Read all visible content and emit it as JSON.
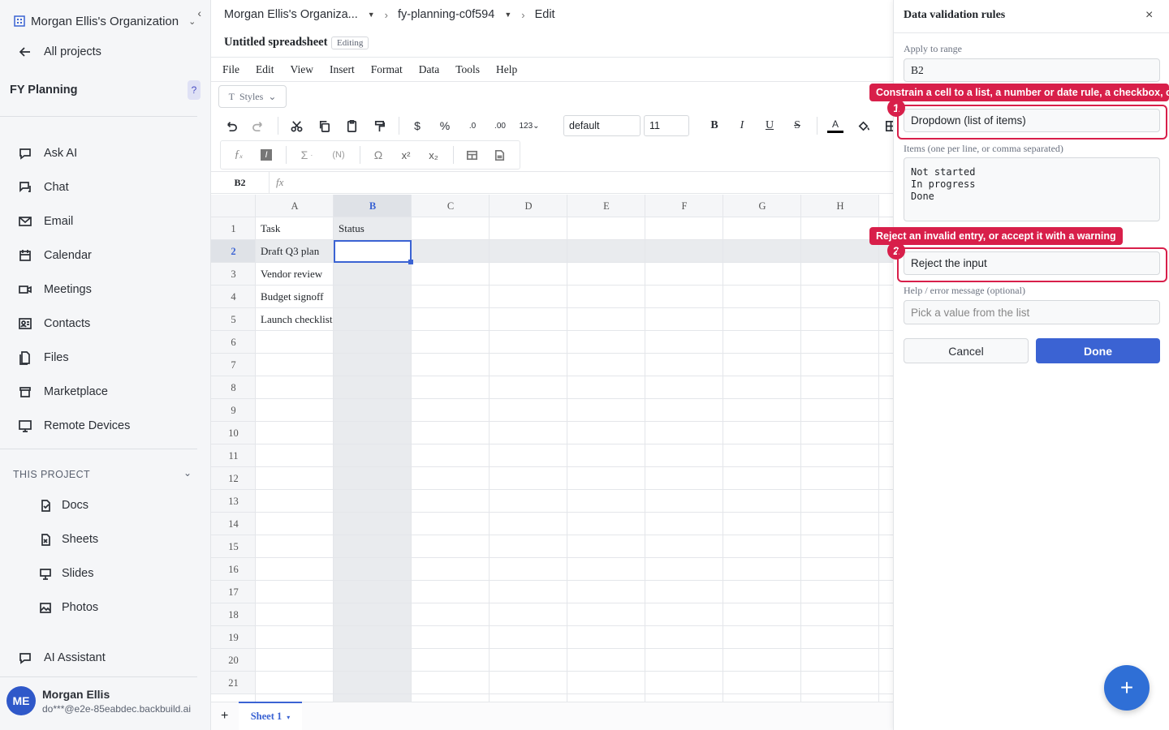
{
  "sidebar": {
    "org_name": "Morgan Ellis's Organization",
    "all_projects": "All projects",
    "project_title": "FY Planning",
    "help": "?",
    "nav": [
      {
        "label": "Ask AI",
        "icon": "chat-bubble-icon"
      },
      {
        "label": "Chat",
        "icon": "message-icon"
      },
      {
        "label": "Email",
        "icon": "mail-icon"
      },
      {
        "label": "Calendar",
        "icon": "calendar-icon"
      },
      {
        "label": "Meetings",
        "icon": "video-icon"
      },
      {
        "label": "Contacts",
        "icon": "contact-card-icon"
      },
      {
        "label": "Files",
        "icon": "files-icon"
      },
      {
        "label": "Marketplace",
        "icon": "store-icon"
      },
      {
        "label": "Remote Devices",
        "icon": "monitor-icon"
      }
    ],
    "section_label": "THIS PROJECT",
    "project_items": [
      {
        "label": "Docs",
        "icon": "doc-icon"
      },
      {
        "label": "Sheets",
        "icon": "sheet-icon"
      },
      {
        "label": "Slides",
        "icon": "presentation-icon"
      },
      {
        "label": "Photos",
        "icon": "photo-icon"
      }
    ],
    "ai_assistant": "AI Assistant",
    "user": {
      "initials": "ME",
      "name": "Morgan Ellis",
      "email": "do***@e2e-85eabdec.backbuild.ai"
    }
  },
  "header": {
    "crumb_org": "Morgan Ellis's Organiza...",
    "crumb_project": "fy-planning-c0f594",
    "crumb_mode": "Edit",
    "doc_title": "Untitled spreadsheet",
    "badge": "Editing"
  },
  "menu": [
    "File",
    "Edit",
    "View",
    "Insert",
    "Format",
    "Data",
    "Tools",
    "Help"
  ],
  "toolbar": {
    "styles": "Styles",
    "font": "default",
    "size": "11",
    "currency": "$",
    "percent": "%",
    "dec_less": ".0",
    "dec_more": ".00",
    "num_format": "123",
    "bold": "B",
    "italic": "I",
    "underline": "U",
    "strike": "S",
    "text_color": "A",
    "sigma": "Σ",
    "named": "(N)",
    "omega": "Ω"
  },
  "formula": {
    "cell_ref": "B2",
    "fx": "fx"
  },
  "grid": {
    "columns": [
      "A",
      "B",
      "C",
      "D",
      "E",
      "F",
      "G",
      "H"
    ],
    "rows": [
      "1",
      "2",
      "3",
      "4",
      "5",
      "6",
      "7",
      "8",
      "9",
      "10",
      "11",
      "12",
      "13",
      "14",
      "15",
      "16",
      "17",
      "18",
      "19",
      "20",
      "21"
    ],
    "cells": {
      "A1": "Task",
      "B1": "Status",
      "A2": "Draft Q3 plan",
      "A3": "Vendor review",
      "A4": "Budget signoff",
      "A5": "Launch checklist"
    }
  },
  "sheet_tabs": {
    "add": "+",
    "active": "Sheet 1"
  },
  "panel": {
    "title": "Data validation rules",
    "close": "×",
    "range_label": "Apply to range",
    "range_value": "B2",
    "rule_value": "Dropdown (list of items)",
    "items_label": "Items (one per line, or comma separated)",
    "items_value": "Not started\nIn progress\nDone",
    "invalid_value": "Reject the input",
    "help_label": "Help / error message (optional)",
    "help_placeholder": "Pick a value from the list",
    "cancel": "Cancel",
    "done": "Done"
  },
  "callouts": [
    {
      "num": "1",
      "text": "Constrain a cell to a list, a number or date rule, a checkbox, or a"
    },
    {
      "num": "2",
      "text": "Reject an invalid entry, or accept it with a warning"
    }
  ],
  "fab": "+",
  "colors": {
    "accent": "#3b63d3",
    "callout": "#d81f4a",
    "avatar": "#2f58c9"
  }
}
